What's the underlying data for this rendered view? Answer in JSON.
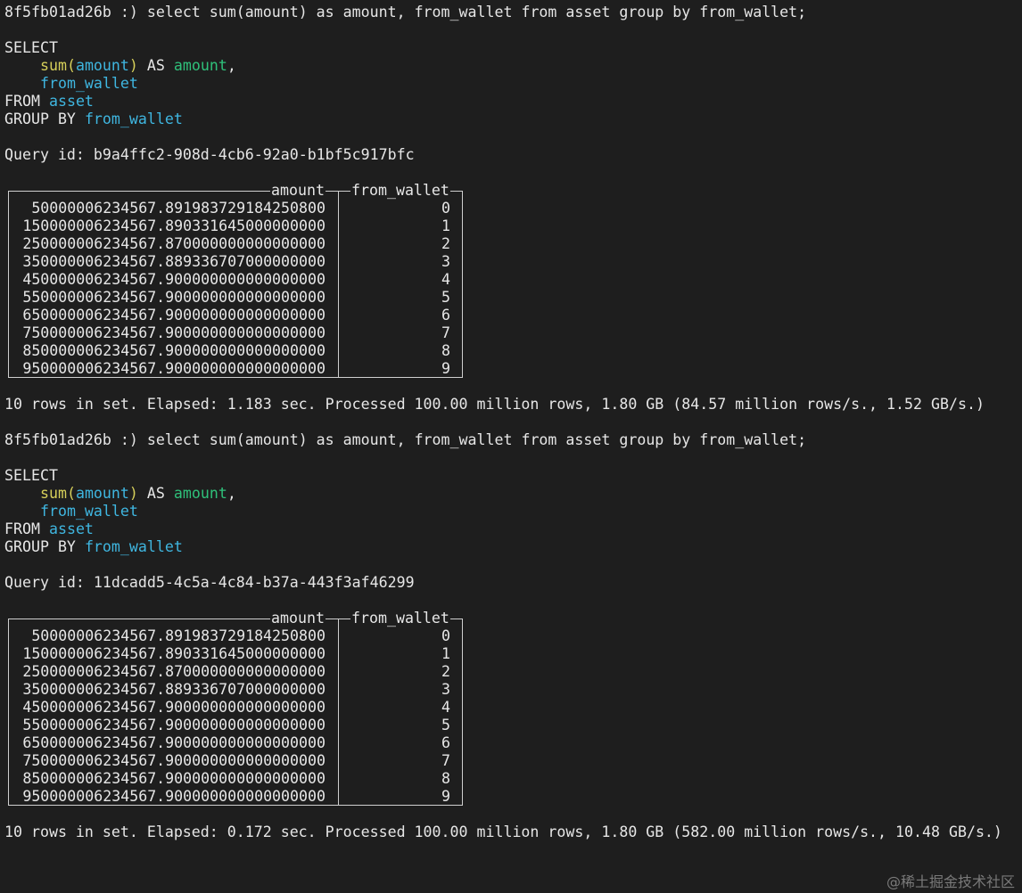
{
  "blocks": [
    {
      "prompt": "8f5fb01ad26b :)",
      "command": "select sum(amount) as amount, from_wallet from asset group by from_wallet;",
      "query_id_label": "Query id:",
      "query_id": "b9a4ffc2-908d-4cb6-92a0-b1bf5c917bfc",
      "columns": [
        "amount",
        "from_wallet"
      ],
      "rows": [
        [
          "50000006234567.891983729184250800",
          "0"
        ],
        [
          "150000006234567.890331645000000000",
          "1"
        ],
        [
          "250000006234567.870000000000000000",
          "2"
        ],
        [
          "350000006234567.889336707000000000",
          "3"
        ],
        [
          "450000006234567.900000000000000000",
          "4"
        ],
        [
          "550000006234567.900000000000000000",
          "5"
        ],
        [
          "650000006234567.900000000000000000",
          "6"
        ],
        [
          "750000006234567.900000000000000000",
          "7"
        ],
        [
          "850000006234567.900000000000000000",
          "8"
        ],
        [
          "950000006234567.900000000000000000",
          "9"
        ]
      ],
      "summary": "10 rows in set. Elapsed: 1.183 sec. Processed 100.00 million rows, 1.80 GB (84.57 million rows/s., 1.52 GB/s.)"
    },
    {
      "prompt": "8f5fb01ad26b :)",
      "command": "select sum(amount) as amount, from_wallet from asset group by from_wallet;",
      "query_id_label": "Query id:",
      "query_id": "11dcadd5-4c5a-4c84-b37a-443f3af46299",
      "columns": [
        "amount",
        "from_wallet"
      ],
      "rows": [
        [
          "50000006234567.891983729184250800",
          "0"
        ],
        [
          "150000006234567.890331645000000000",
          "1"
        ],
        [
          "250000006234567.870000000000000000",
          "2"
        ],
        [
          "350000006234567.889336707000000000",
          "3"
        ],
        [
          "450000006234567.900000000000000000",
          "4"
        ],
        [
          "550000006234567.900000000000000000",
          "5"
        ],
        [
          "650000006234567.900000000000000000",
          "6"
        ],
        [
          "750000006234567.900000000000000000",
          "7"
        ],
        [
          "850000006234567.900000000000000000",
          "8"
        ],
        [
          "950000006234567.900000000000000000",
          "9"
        ]
      ],
      "summary": "10 rows in set. Elapsed: 0.172 sec. Processed 100.00 million rows, 1.80 GB (582.00 million rows/s., 10.48 GB/s.)"
    }
  ],
  "formatted_sql": {
    "select": "SELECT",
    "fn": "sum",
    "arg": "amount",
    "as": "AS",
    "alias": "amount",
    "col": "from_wallet",
    "from": "FROM",
    "table": "asset",
    "group_by": "GROUP BY",
    "group_col": "from_wallet"
  },
  "watermark": "@稀土掘金技术社区",
  "colors": {
    "background": "#1e1e1e",
    "text": "#e6e6e6",
    "function": "#d6cf5a",
    "identifier": "#3fb6e0",
    "alias": "#2fc07a"
  }
}
